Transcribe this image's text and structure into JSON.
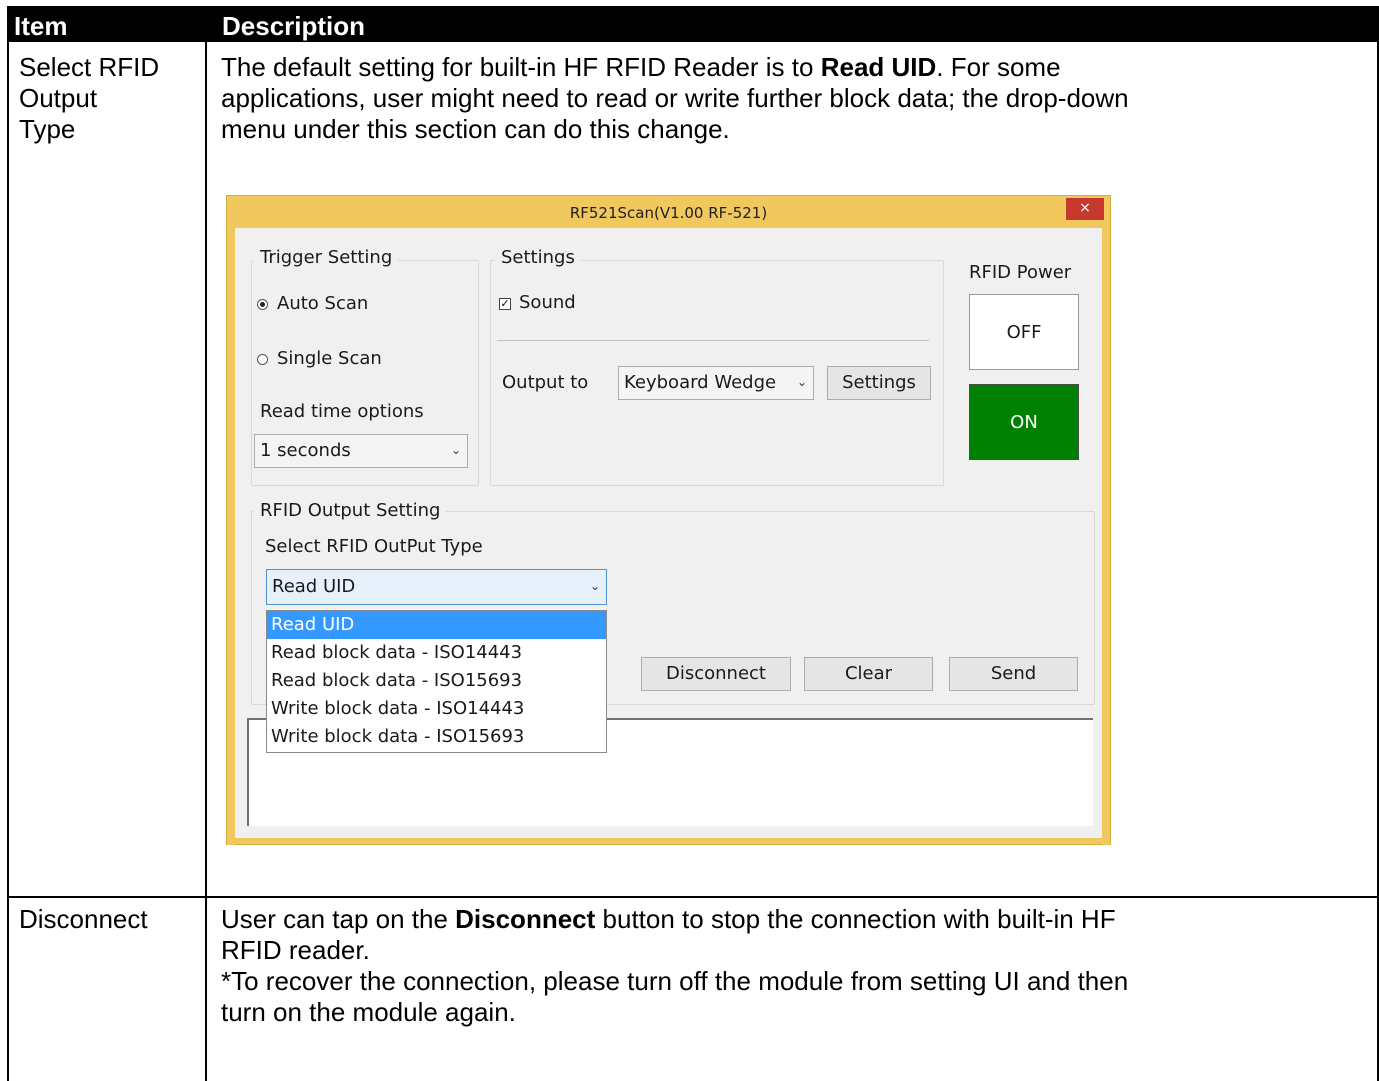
{
  "table": {
    "headers": [
      "Item",
      "Description"
    ],
    "rows": [
      {
        "item_lines": [
          "Select RFID",
          "Output",
          "Type"
        ],
        "desc_lines": [
          {
            "before": "The default setting for built-in HF RFID Reader is to ",
            "bold": "Read UID",
            "after": ". For some"
          },
          {
            "before": "applications, user might need to read or write further block data; the drop-down",
            "bold": "",
            "after": ""
          },
          {
            "before": "menu under this section can do this change.",
            "bold": "",
            "after": ""
          }
        ]
      },
      {
        "item_lines": [
          "Disconnect"
        ],
        "desc_lines": [
          {
            "before": "User can tap on the ",
            "bold": "Disconnect",
            "after": " button to stop the connection with built-in HF"
          },
          {
            "before": "RFID reader.",
            "bold": "",
            "after": ""
          },
          {
            "before": "*To recover the connection, please turn off the module from setting UI and then",
            "bold": "",
            "after": ""
          },
          {
            "before": "turn on the module again.",
            "bold": "",
            "after": ""
          }
        ]
      }
    ]
  },
  "dialog": {
    "title": "RF521Scan(V1.00 RF-521)",
    "close_glyph": "×",
    "trigger": {
      "label": "Trigger Setting",
      "auto_scan": "Auto Scan",
      "single_scan": "Single Scan",
      "selected": "Auto Scan",
      "read_time_label": "Read time options",
      "read_time_value": "1 seconds"
    },
    "settings": {
      "label": "Settings",
      "sound_label": "Sound",
      "sound_checked": true,
      "output_to_label": "Output to",
      "output_to_value": "Keyboard Wedge",
      "settings_button": "Settings"
    },
    "power": {
      "label": "RFID Power",
      "off_button": "OFF",
      "on_button": "ON",
      "on_color": "#008000"
    },
    "output_setting": {
      "label": "RFID Output Setting",
      "select_label": "Select RFID OutPut Type",
      "selected_value": "Read UID",
      "options": [
        "Read UID",
        "Read block data - ISO14443",
        "Read block data - ISO15693",
        "Write block data - ISO14443",
        "Write block data - ISO15693"
      ],
      "highlight_color": "#3399ff",
      "disconnect_button": "Disconnect",
      "clear_button": "Clear",
      "send_button": "Send"
    },
    "arrow_glyph": "⌄",
    "check_glyph": "✓"
  }
}
